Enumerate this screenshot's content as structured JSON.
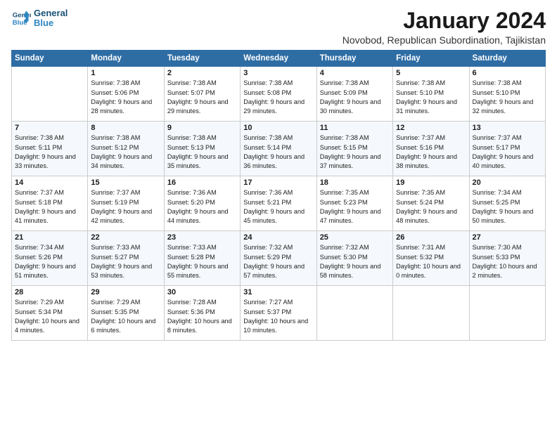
{
  "logo": {
    "line1": "General",
    "line2": "Blue"
  },
  "title": "January 2024",
  "subtitle": "Novobod, Republican Subordination, Tajikistan",
  "headers": [
    "Sunday",
    "Monday",
    "Tuesday",
    "Wednesday",
    "Thursday",
    "Friday",
    "Saturday"
  ],
  "weeks": [
    [
      {
        "day": "",
        "sunrise": "",
        "sunset": "",
        "daylight": ""
      },
      {
        "day": "1",
        "sunrise": "Sunrise: 7:38 AM",
        "sunset": "Sunset: 5:06 PM",
        "daylight": "Daylight: 9 hours and 28 minutes."
      },
      {
        "day": "2",
        "sunrise": "Sunrise: 7:38 AM",
        "sunset": "Sunset: 5:07 PM",
        "daylight": "Daylight: 9 hours and 29 minutes."
      },
      {
        "day": "3",
        "sunrise": "Sunrise: 7:38 AM",
        "sunset": "Sunset: 5:08 PM",
        "daylight": "Daylight: 9 hours and 29 minutes."
      },
      {
        "day": "4",
        "sunrise": "Sunrise: 7:38 AM",
        "sunset": "Sunset: 5:09 PM",
        "daylight": "Daylight: 9 hours and 30 minutes."
      },
      {
        "day": "5",
        "sunrise": "Sunrise: 7:38 AM",
        "sunset": "Sunset: 5:10 PM",
        "daylight": "Daylight: 9 hours and 31 minutes."
      },
      {
        "day": "6",
        "sunrise": "Sunrise: 7:38 AM",
        "sunset": "Sunset: 5:10 PM",
        "daylight": "Daylight: 9 hours and 32 minutes."
      }
    ],
    [
      {
        "day": "7",
        "sunrise": "Sunrise: 7:38 AM",
        "sunset": "Sunset: 5:11 PM",
        "daylight": "Daylight: 9 hours and 33 minutes."
      },
      {
        "day": "8",
        "sunrise": "Sunrise: 7:38 AM",
        "sunset": "Sunset: 5:12 PM",
        "daylight": "Daylight: 9 hours and 34 minutes."
      },
      {
        "day": "9",
        "sunrise": "Sunrise: 7:38 AM",
        "sunset": "Sunset: 5:13 PM",
        "daylight": "Daylight: 9 hours and 35 minutes."
      },
      {
        "day": "10",
        "sunrise": "Sunrise: 7:38 AM",
        "sunset": "Sunset: 5:14 PM",
        "daylight": "Daylight: 9 hours and 36 minutes."
      },
      {
        "day": "11",
        "sunrise": "Sunrise: 7:38 AM",
        "sunset": "Sunset: 5:15 PM",
        "daylight": "Daylight: 9 hours and 37 minutes."
      },
      {
        "day": "12",
        "sunrise": "Sunrise: 7:37 AM",
        "sunset": "Sunset: 5:16 PM",
        "daylight": "Daylight: 9 hours and 38 minutes."
      },
      {
        "day": "13",
        "sunrise": "Sunrise: 7:37 AM",
        "sunset": "Sunset: 5:17 PM",
        "daylight": "Daylight: 9 hours and 40 minutes."
      }
    ],
    [
      {
        "day": "14",
        "sunrise": "Sunrise: 7:37 AM",
        "sunset": "Sunset: 5:18 PM",
        "daylight": "Daylight: 9 hours and 41 minutes."
      },
      {
        "day": "15",
        "sunrise": "Sunrise: 7:37 AM",
        "sunset": "Sunset: 5:19 PM",
        "daylight": "Daylight: 9 hours and 42 minutes."
      },
      {
        "day": "16",
        "sunrise": "Sunrise: 7:36 AM",
        "sunset": "Sunset: 5:20 PM",
        "daylight": "Daylight: 9 hours and 44 minutes."
      },
      {
        "day": "17",
        "sunrise": "Sunrise: 7:36 AM",
        "sunset": "Sunset: 5:21 PM",
        "daylight": "Daylight: 9 hours and 45 minutes."
      },
      {
        "day": "18",
        "sunrise": "Sunrise: 7:35 AM",
        "sunset": "Sunset: 5:23 PM",
        "daylight": "Daylight: 9 hours and 47 minutes."
      },
      {
        "day": "19",
        "sunrise": "Sunrise: 7:35 AM",
        "sunset": "Sunset: 5:24 PM",
        "daylight": "Daylight: 9 hours and 48 minutes."
      },
      {
        "day": "20",
        "sunrise": "Sunrise: 7:34 AM",
        "sunset": "Sunset: 5:25 PM",
        "daylight": "Daylight: 9 hours and 50 minutes."
      }
    ],
    [
      {
        "day": "21",
        "sunrise": "Sunrise: 7:34 AM",
        "sunset": "Sunset: 5:26 PM",
        "daylight": "Daylight: 9 hours and 51 minutes."
      },
      {
        "day": "22",
        "sunrise": "Sunrise: 7:33 AM",
        "sunset": "Sunset: 5:27 PM",
        "daylight": "Daylight: 9 hours and 53 minutes."
      },
      {
        "day": "23",
        "sunrise": "Sunrise: 7:33 AM",
        "sunset": "Sunset: 5:28 PM",
        "daylight": "Daylight: 9 hours and 55 minutes."
      },
      {
        "day": "24",
        "sunrise": "Sunrise: 7:32 AM",
        "sunset": "Sunset: 5:29 PM",
        "daylight": "Daylight: 9 hours and 57 minutes."
      },
      {
        "day": "25",
        "sunrise": "Sunrise: 7:32 AM",
        "sunset": "Sunset: 5:30 PM",
        "daylight": "Daylight: 9 hours and 58 minutes."
      },
      {
        "day": "26",
        "sunrise": "Sunrise: 7:31 AM",
        "sunset": "Sunset: 5:32 PM",
        "daylight": "Daylight: 10 hours and 0 minutes."
      },
      {
        "day": "27",
        "sunrise": "Sunrise: 7:30 AM",
        "sunset": "Sunset: 5:33 PM",
        "daylight": "Daylight: 10 hours and 2 minutes."
      }
    ],
    [
      {
        "day": "28",
        "sunrise": "Sunrise: 7:29 AM",
        "sunset": "Sunset: 5:34 PM",
        "daylight": "Daylight: 10 hours and 4 minutes."
      },
      {
        "day": "29",
        "sunrise": "Sunrise: 7:29 AM",
        "sunset": "Sunset: 5:35 PM",
        "daylight": "Daylight: 10 hours and 6 minutes."
      },
      {
        "day": "30",
        "sunrise": "Sunrise: 7:28 AM",
        "sunset": "Sunset: 5:36 PM",
        "daylight": "Daylight: 10 hours and 8 minutes."
      },
      {
        "day": "31",
        "sunrise": "Sunrise: 7:27 AM",
        "sunset": "Sunset: 5:37 PM",
        "daylight": "Daylight: 10 hours and 10 minutes."
      },
      {
        "day": "",
        "sunrise": "",
        "sunset": "",
        "daylight": ""
      },
      {
        "day": "",
        "sunrise": "",
        "sunset": "",
        "daylight": ""
      },
      {
        "day": "",
        "sunrise": "",
        "sunset": "",
        "daylight": ""
      }
    ]
  ]
}
